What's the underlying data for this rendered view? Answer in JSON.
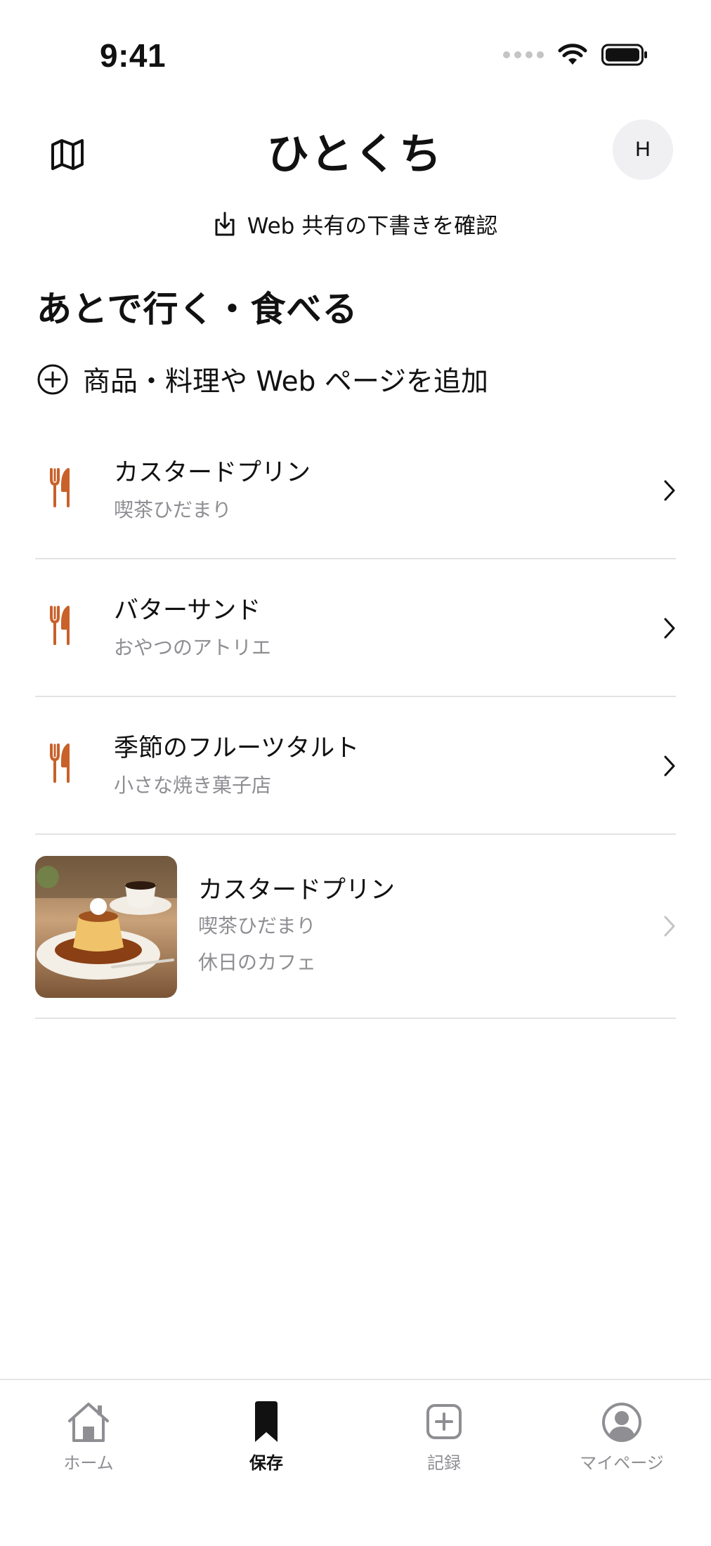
{
  "status_bar": {
    "time": "9:41"
  },
  "header": {
    "title": "ひとくち",
    "avatar_initial": "H"
  },
  "draft_link": {
    "label": "Web 共有の下書きを確認"
  },
  "section": {
    "title": "あとで行く・食べる"
  },
  "add_action": {
    "label": "商品・料理や Web ページを追加"
  },
  "items": [
    {
      "title": "カスタードプリン",
      "shop": "喫茶ひだまり"
    },
    {
      "title": "バターサンド",
      "shop": "おやつのアトリエ"
    },
    {
      "title": "季節のフルーツタルト",
      "shop": "小さな焼き菓子店"
    }
  ],
  "photo_item": {
    "title": "カスタードプリン",
    "shop": "喫茶ひだまり",
    "collection": "休日のカフェ"
  },
  "tabs": [
    {
      "label": "ホーム",
      "icon": "house-icon",
      "active": false
    },
    {
      "label": "保存",
      "icon": "bookmark-icon",
      "active": true
    },
    {
      "label": "記録",
      "icon": "plus-square-icon",
      "active": false
    },
    {
      "label": "マイページ",
      "icon": "person-circle-icon",
      "active": false
    }
  ],
  "colors": {
    "accent_fork": "#c8612a",
    "secondary_text": "#8e8e93",
    "divider": "#e3e3e3"
  }
}
